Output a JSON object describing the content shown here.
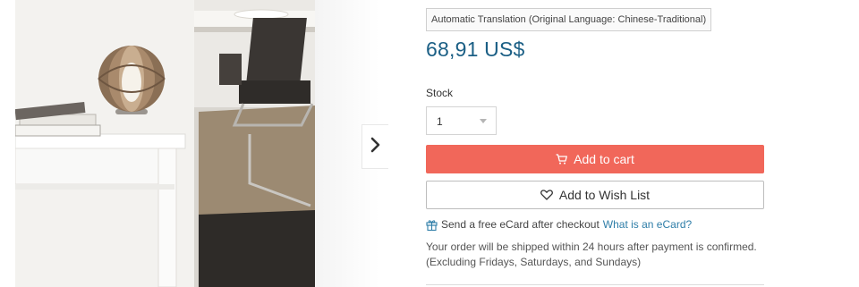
{
  "translation": {
    "label": "Automatic Translation (Original Language: Chinese-Traditional)"
  },
  "product": {
    "price": "68,91 US$"
  },
  "stock": {
    "label": "Stock",
    "quantity": "1"
  },
  "buttons": {
    "add_to_cart": "Add to cart",
    "add_to_wishlist": "Add to Wish List"
  },
  "ecard": {
    "text": "Send a free eCard after checkout",
    "link": "What is an eCard?"
  },
  "shipping": {
    "line1": "Your order will be shipped within 24 hours after payment is confirmed.",
    "line2": "(Excluding Fridays, Saturdays, and Sundays)"
  },
  "icons": {
    "next": "chevron-right-icon",
    "cart": "cart-icon",
    "heart": "heart-icon",
    "gift": "gift-icon"
  },
  "colors": {
    "price": "#1b5f85",
    "cart_button": "#f1675a",
    "link": "#2f7ea8"
  }
}
